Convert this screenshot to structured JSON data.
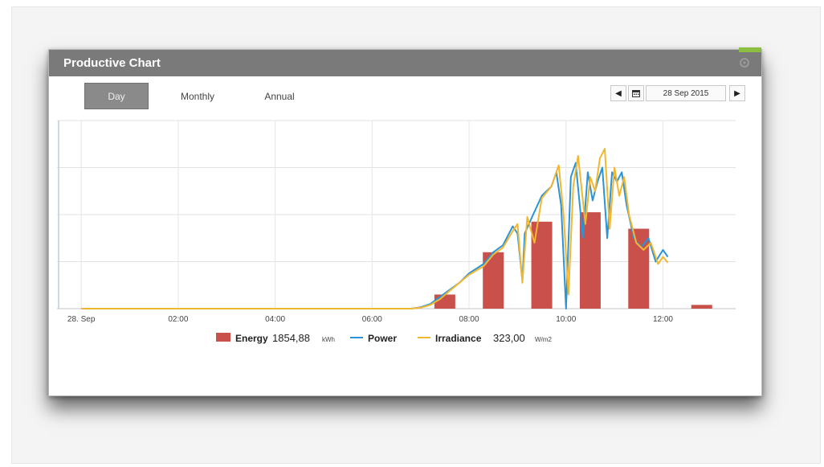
{
  "widget": {
    "title": "Productive Chart",
    "tabs": [
      {
        "label": "Day",
        "active": true
      },
      {
        "label": "Monthly",
        "active": false
      },
      {
        "label": "Annual",
        "active": false
      }
    ],
    "date": "28 Sep 2015",
    "prev_icon": "triangle-left-icon",
    "next_icon": "triangle-right-icon",
    "calendar_icon": "calendar-icon",
    "settings_icon": "gear-icon"
  },
  "colors": {
    "energy": "#c9504b",
    "power": "#2a94d6",
    "irradiance": "#f2b731",
    "titlebar": "#7a7a7a",
    "accent": "#8cbf3f"
  },
  "chart_data": {
    "type": "bar+line",
    "x_tick_labels": [
      "28. Sep",
      "02:00",
      "04:00",
      "06:00",
      "08:00",
      "10:00",
      "12:00"
    ],
    "x_range_hours": [
      -0.5,
      13.5
    ],
    "grid": true,
    "legend_position": "bottom-center",
    "legend": {
      "energy": {
        "name": "Energy",
        "value": "1854,88",
        "unit": "kWh"
      },
      "power": {
        "name": "Power"
      },
      "irradiance": {
        "name": "Irradiance",
        "value": "323,00",
        "unit": "W/m2"
      }
    },
    "energy_bars": {
      "hours": [
        7.5,
        8.5,
        9.5,
        10.5,
        11.5,
        12.8
      ],
      "values": [
        0.3,
        1.2,
        1.85,
        2.05,
        1.7,
        0.08
      ]
    },
    "power_series": [
      [
        0.0,
        0
      ],
      [
        6.8,
        0
      ],
      [
        7.0,
        0.03
      ],
      [
        7.2,
        0.1
      ],
      [
        7.4,
        0.25
      ],
      [
        7.6,
        0.4
      ],
      [
        7.8,
        0.55
      ],
      [
        8.0,
        0.75
      ],
      [
        8.3,
        0.95
      ],
      [
        8.5,
        1.2
      ],
      [
        8.7,
        1.35
      ],
      [
        8.9,
        1.75
      ],
      [
        9.0,
        1.6
      ],
      [
        9.1,
        0.6
      ],
      [
        9.15,
        1.6
      ],
      [
        9.3,
        1.95
      ],
      [
        9.5,
        2.4
      ],
      [
        9.7,
        2.6
      ],
      [
        9.8,
        2.9
      ],
      [
        9.9,
        2.2
      ],
      [
        10.0,
        0.0
      ],
      [
        10.1,
        2.8
      ],
      [
        10.2,
        3.1
      ],
      [
        10.35,
        1.5
      ],
      [
        10.45,
        2.9
      ],
      [
        10.55,
        2.3
      ],
      [
        10.65,
        2.7
      ],
      [
        10.75,
        3.0
      ],
      [
        10.85,
        1.5
      ],
      [
        10.95,
        2.9
      ],
      [
        11.05,
        2.7
      ],
      [
        11.15,
        2.9
      ],
      [
        11.25,
        2.2
      ],
      [
        11.4,
        1.5
      ],
      [
        11.55,
        1.3
      ],
      [
        11.7,
        1.5
      ],
      [
        11.85,
        1.0
      ],
      [
        12.0,
        1.25
      ],
      [
        12.1,
        1.1
      ]
    ],
    "irradiance_series": [
      [
        0.0,
        0
      ],
      [
        6.8,
        0
      ],
      [
        7.0,
        0.02
      ],
      [
        7.2,
        0.08
      ],
      [
        7.4,
        0.2
      ],
      [
        7.6,
        0.38
      ],
      [
        7.8,
        0.55
      ],
      [
        8.0,
        0.72
      ],
      [
        8.3,
        0.9
      ],
      [
        8.5,
        1.15
      ],
      [
        8.7,
        1.3
      ],
      [
        8.9,
        1.65
      ],
      [
        9.0,
        1.8
      ],
      [
        9.1,
        0.55
      ],
      [
        9.2,
        1.95
      ],
      [
        9.35,
        1.4
      ],
      [
        9.5,
        2.35
      ],
      [
        9.7,
        2.6
      ],
      [
        9.85,
        3.05
      ],
      [
        9.95,
        2.0
      ],
      [
        10.05,
        0.3
      ],
      [
        10.15,
        2.6
      ],
      [
        10.25,
        3.25
      ],
      [
        10.4,
        1.8
      ],
      [
        10.5,
        2.8
      ],
      [
        10.6,
        2.5
      ],
      [
        10.7,
        3.2
      ],
      [
        10.8,
        3.4
      ],
      [
        10.9,
        1.7
      ],
      [
        11.0,
        3.0
      ],
      [
        11.1,
        2.4
      ],
      [
        11.2,
        2.8
      ],
      [
        11.3,
        2.0
      ],
      [
        11.45,
        1.4
      ],
      [
        11.6,
        1.25
      ],
      [
        11.75,
        1.4
      ],
      [
        11.9,
        0.95
      ],
      [
        12.0,
        1.1
      ],
      [
        12.1,
        0.98
      ]
    ],
    "y_range": [
      0,
      4.0
    ],
    "y_tick_labels": []
  }
}
